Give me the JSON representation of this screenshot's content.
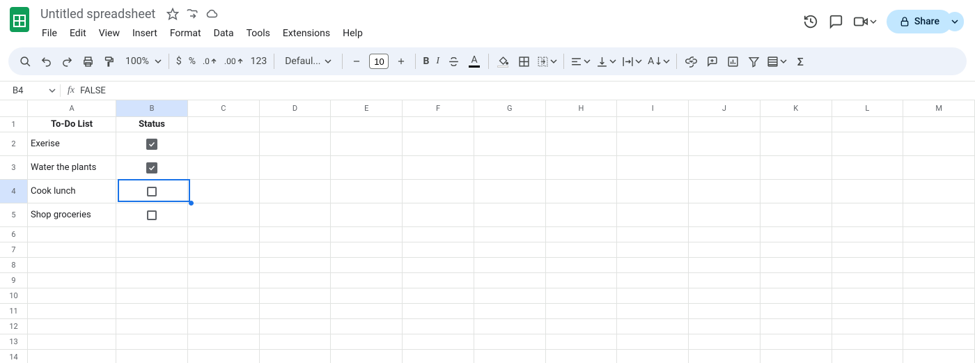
{
  "doc": {
    "title": "Untitled spreadsheet"
  },
  "menu": {
    "file": "File",
    "edit": "Edit",
    "view": "View",
    "insert": "Insert",
    "format": "Format",
    "data": "Data",
    "tools": "Tools",
    "extensions": "Extensions",
    "help": "Help"
  },
  "share": {
    "label": "Share"
  },
  "toolbar": {
    "zoom": "100%",
    "currency": "$",
    "percent": "%",
    "dec_dec": ".0",
    "inc_dec": ".00",
    "num_format": "123",
    "font": "Defaul...",
    "font_size": "10",
    "bold": "B",
    "italic": "I"
  },
  "name_box": "B4",
  "formula": "FALSE",
  "columns": [
    "A",
    "B",
    "C",
    "D",
    "E",
    "F",
    "G",
    "H",
    "I",
    "J",
    "K",
    "L",
    "M"
  ],
  "row_count": 14,
  "tall_rows": [
    2,
    3,
    4,
    5
  ],
  "selected": {
    "col": "B",
    "row": 4
  },
  "data": {
    "A1": {
      "text": "To-Do List",
      "bold": true,
      "align": "center"
    },
    "B1": {
      "text": "Status",
      "bold": true,
      "align": "center"
    },
    "A2": {
      "text": "Exerise"
    },
    "A3": {
      "text": "Water the plants"
    },
    "A4": {
      "text": "Cook lunch"
    },
    "A5": {
      "text": "Shop groceries"
    },
    "B2": {
      "checkbox": true,
      "checked": true
    },
    "B3": {
      "checkbox": true,
      "checked": true
    },
    "B4": {
      "checkbox": true,
      "checked": false
    },
    "B5": {
      "checkbox": true,
      "checked": false
    }
  }
}
